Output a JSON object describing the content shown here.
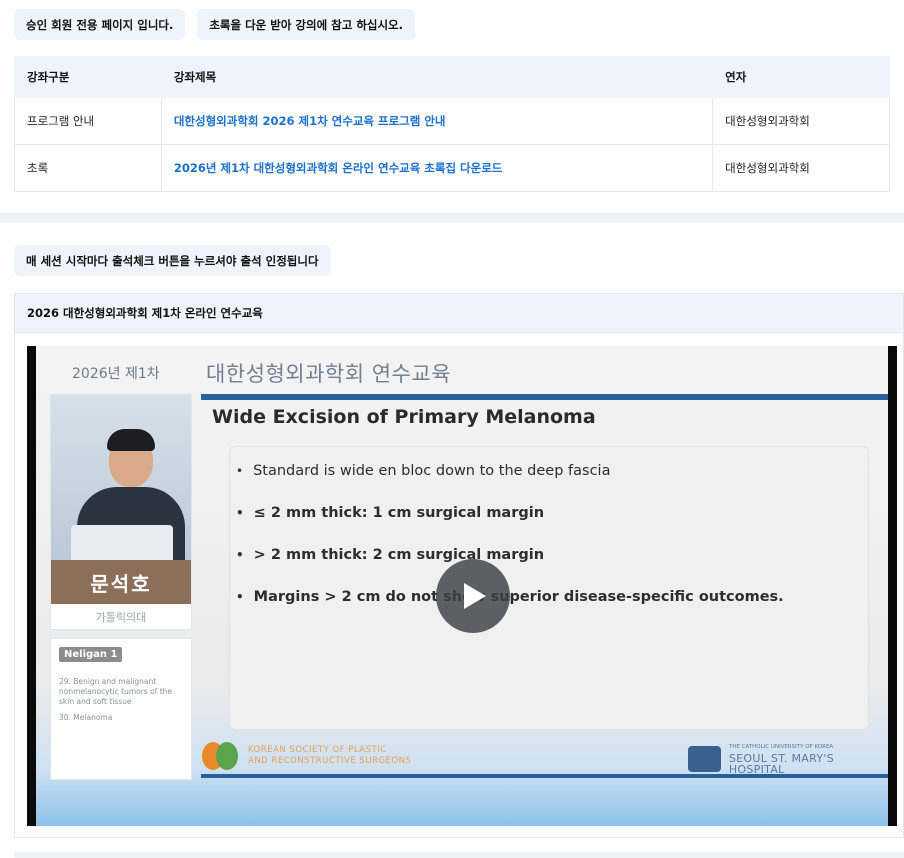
{
  "notices": {
    "members_only": "승인 회원 전용 페이지 입니다.",
    "abstract_note": "초록을 다운 받아 강의에 참고 하십시오.",
    "attendance_note": "매 세션 시작마다 출석체크 버튼을 누르셔야 출석 인정됩니다"
  },
  "table": {
    "headers": {
      "category": "강좌구분",
      "title": "강좌제목",
      "speaker": "연자"
    },
    "rows": [
      {
        "category": "프로그램 안내",
        "title": "대한성형외과학회 2026 제1차 연수교육 프로그램 안내",
        "speaker": "대한성형외과학회"
      },
      {
        "category": "초록",
        "title": "2026년 제1차 대한성형외과학회 온라인 연수교육 초록집 다운로드",
        "speaker": "대한성형외과학회"
      }
    ]
  },
  "video_section": {
    "title": "2026 대한성형외과학회 제1차 온라인 연수교육"
  },
  "slide": {
    "edition": "2026년 제1차",
    "society_title": "대한성형외과학회 연수교육",
    "speaker_name": "문석호",
    "speaker_affiliation": "가톨릭의대",
    "topic_badge": "Neligan 1",
    "topics": [
      "29. Benign and malignant nonmelanocytic tumors of the skin and soft tissue",
      "30. Melanoma"
    ],
    "content_title": "Wide Excision of Primary Melanoma",
    "bullets": [
      "Standard is wide en bloc down to the deep fascia",
      "≤ 2 mm thick: 1 cm surgical margin",
      "> 2 mm thick: 2 cm surgical margin",
      "Margins > 2 cm do not show superior disease-specific outcomes."
    ],
    "logo_left_line1": "KOREAN SOCIETY OF PLASTIC",
    "logo_left_line2": "AND RECONSTRUCTIVE SURGEONS",
    "logo_right_sub": "THE CATHOLIC UNIVERSITY OF KOREA",
    "logo_right_name": "SEOUL ST. MARY'S HOSPITAL"
  },
  "colors": {
    "accent_link": "#1a6fd1",
    "chip_bg": "#eef4fb",
    "slide_rule": "#2a5f9e",
    "name_bar": "#8d6e59"
  },
  "icons": {
    "play": "play-icon"
  }
}
